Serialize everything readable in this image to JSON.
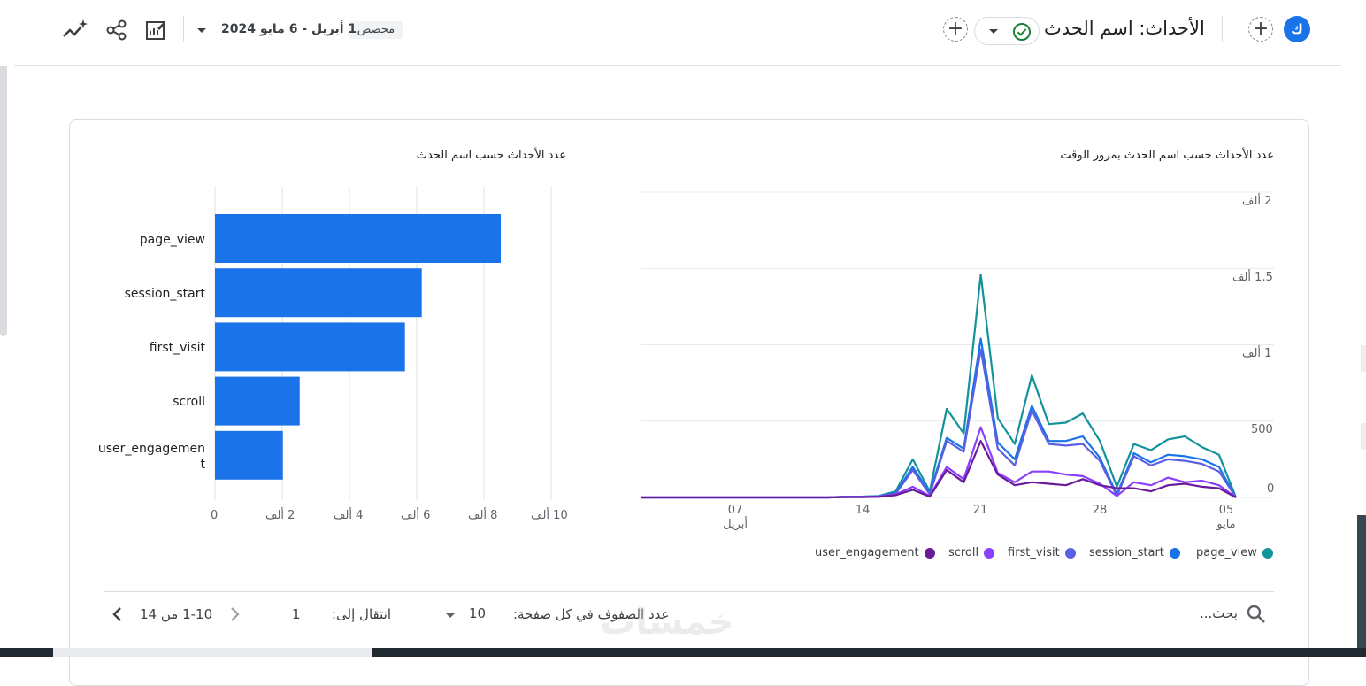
{
  "topbar": {
    "avatar_letter": "ك",
    "title": "الأحداث: اسم الحدث",
    "date_label": "مخصص",
    "date_range": "1 أبريل - 6 مايو 2024",
    "add_icon": "plus-icon",
    "status_icon": "check-circle-icon",
    "dropdown_icon": "caret-down-icon",
    "tool_icons": [
      "insights-icon",
      "share-icon",
      "edit-report-icon"
    ]
  },
  "line_chart": {
    "title": "عدد الأحداث حسب اسم الحدث بمرور الوقت",
    "y_ticks": [
      "0",
      "500",
      "1 ألف",
      "1.5 ألف",
      "2 ألف"
    ],
    "x_ticks": [
      {
        "day": "07",
        "month": "أبريل"
      },
      {
        "day": "14",
        "month": ""
      },
      {
        "day": "21",
        "month": ""
      },
      {
        "day": "28",
        "month": ""
      },
      {
        "day": "05",
        "month": "مايو"
      }
    ]
  },
  "bar_chart_meta": {
    "title": "عدد الأحداث حسب اسم الحدث",
    "x_ticks": [
      "0",
      "2 ألف",
      "4 ألف",
      "6 ألف",
      "8 ألف",
      "10 ألف"
    ],
    "bar_color": "#1a73e8"
  },
  "chart_data": [
    {
      "type": "line",
      "title": "عدد الأحداث حسب اسم الحدث بمرور الوقت",
      "x_start": "2024-04-01",
      "x": [
        "2024-04-01",
        "2024-04-02",
        "2024-04-03",
        "2024-04-04",
        "2024-04-05",
        "2024-04-06",
        "2024-04-07",
        "2024-04-08",
        "2024-04-09",
        "2024-04-10",
        "2024-04-11",
        "2024-04-12",
        "2024-04-13",
        "2024-04-14",
        "2024-04-15",
        "2024-04-16",
        "2024-04-17",
        "2024-04-18",
        "2024-04-19",
        "2024-04-20",
        "2024-04-21",
        "2024-04-22",
        "2024-04-23",
        "2024-04-24",
        "2024-04-25",
        "2024-04-26",
        "2024-04-27",
        "2024-04-28",
        "2024-04-29",
        "2024-04-30",
        "2024-05-01",
        "2024-05-02",
        "2024-05-03",
        "2024-05-04",
        "2024-05-05",
        "2024-05-06"
      ],
      "ylim": [
        0,
        2000
      ],
      "series": [
        {
          "name": "page_view",
          "color": "#12939a",
          "values": [
            0,
            0,
            0,
            0,
            0,
            0,
            0,
            0,
            0,
            0,
            0,
            0,
            5,
            5,
            10,
            40,
            250,
            40,
            580,
            420,
            1460,
            520,
            350,
            800,
            480,
            490,
            550,
            370,
            70,
            350,
            310,
            380,
            400,
            330,
            280,
            0
          ]
        },
        {
          "name": "session_start",
          "color": "#1a73e8",
          "values": [
            0,
            0,
            0,
            0,
            0,
            0,
            0,
            0,
            0,
            0,
            0,
            0,
            5,
            5,
            8,
            30,
            200,
            30,
            390,
            320,
            1040,
            360,
            250,
            600,
            370,
            370,
            400,
            260,
            20,
            290,
            230,
            280,
            270,
            250,
            200,
            0
          ]
        },
        {
          "name": "first_visit",
          "color": "#5b5fe3",
          "values": [
            0,
            0,
            0,
            0,
            0,
            0,
            0,
            0,
            0,
            0,
            0,
            0,
            4,
            4,
            6,
            25,
            180,
            20,
            370,
            300,
            970,
            320,
            210,
            570,
            350,
            340,
            350,
            240,
            10,
            270,
            210,
            250,
            240,
            220,
            170,
            0
          ]
        },
        {
          "name": "scroll",
          "color": "#8a3ffc",
          "values": [
            0,
            0,
            0,
            0,
            0,
            0,
            0,
            0,
            0,
            0,
            0,
            0,
            3,
            3,
            5,
            20,
            70,
            10,
            200,
            120,
            460,
            160,
            100,
            170,
            170,
            150,
            140,
            90,
            10,
            100,
            80,
            130,
            100,
            110,
            80,
            0
          ]
        },
        {
          "name": "user_engagement",
          "color": "#6a1b9a",
          "values": [
            0,
            0,
            0,
            0,
            0,
            0,
            0,
            0,
            0,
            0,
            0,
            0,
            2,
            2,
            4,
            15,
            50,
            5,
            180,
            100,
            370,
            150,
            80,
            100,
            90,
            80,
            120,
            80,
            60,
            60,
            40,
            80,
            90,
            70,
            60,
            0
          ]
        }
      ],
      "legend_position": "bottom-right",
      "grid": true
    },
    {
      "type": "bar",
      "orientation": "horizontal",
      "title": "عدد الأحداث حسب اسم الحدث",
      "categories": [
        "page_view",
        "session_start",
        "first_visit",
        "scroll",
        "user_engagement"
      ],
      "values": [
        8500,
        6150,
        5650,
        2520,
        2020
      ],
      "xlim": [
        0,
        10000
      ],
      "grid": true
    }
  ],
  "footer": {
    "search_placeholder": "بحث...",
    "rows_per_page_label": "عدد الصفوف في كل صفحة:",
    "rows_per_page_value": "10",
    "goto_label": "انتقال إلى:",
    "goto_value": "1",
    "pagination_text": "1-10 من 14"
  },
  "watermark": "خمسات"
}
